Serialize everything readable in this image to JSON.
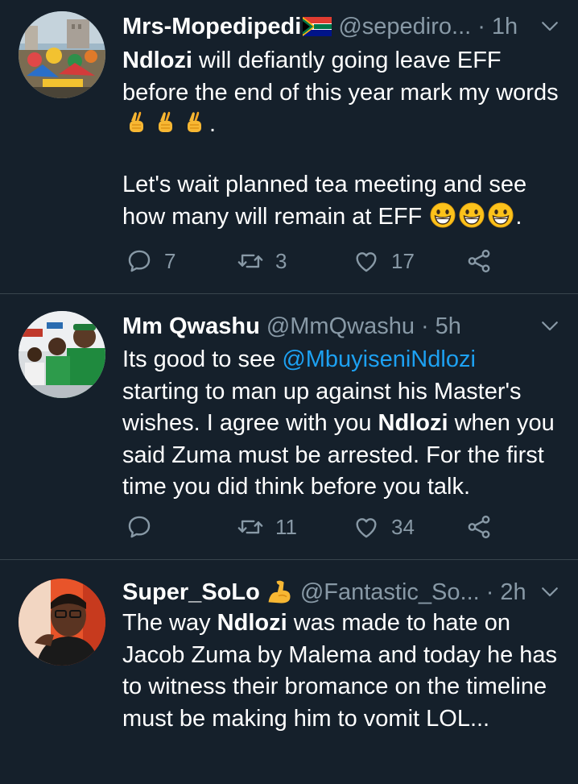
{
  "tweets": [
    {
      "name": "Mrs-Mopedipedi",
      "handle": "@sepediro...",
      "dot": "·",
      "time": "1h",
      "text_p1_bold": "Ndlozi",
      "text_p1_rest": " will defiantly going leave EFF before the end of this year mark my words",
      "text_p1_end": ".",
      "text_p2": "Let's wait planned tea meeting and see how many will remain at EFF",
      "text_p2_end": ".",
      "replies": "7",
      "retweets": "3",
      "likes": "17"
    },
    {
      "name": "Mm Qwashu",
      "handle": "@MmQwashu",
      "dot": "·",
      "time": "5h",
      "text_a": "Its good to see ",
      "mention": "@MbuyiseniNdlozi",
      "text_b": " starting to man up against his Master's wishes. I agree with you ",
      "bold": "Ndlozi",
      "text_c": " when you said Zuma must be arrested. For the first time you did think before you talk.",
      "replies": "",
      "retweets": "11",
      "likes": "34"
    },
    {
      "name": "Super_SoLo",
      "handle": "@Fantastic_So...",
      "dot": "·",
      "time": "2h",
      "text_a": "The way ",
      "bold": "Ndlozi",
      "text_b": " was made to hate on Jacob Zuma by Malema and today he has to witness their bromance on the timeline must be making him to vomit LOL..."
    }
  ],
  "colors": {
    "background": "#15202b",
    "divider": "#38444d",
    "secondary_text": "#8899a6",
    "link": "#1da1f2"
  },
  "icons": [
    "reply-icon",
    "retweet-icon",
    "like-icon",
    "share-icon",
    "chevron-down-icon",
    "crossed-fingers-emoji",
    "grinning-emoji",
    "flexed-biceps-emoji",
    "south-africa-flag"
  ]
}
